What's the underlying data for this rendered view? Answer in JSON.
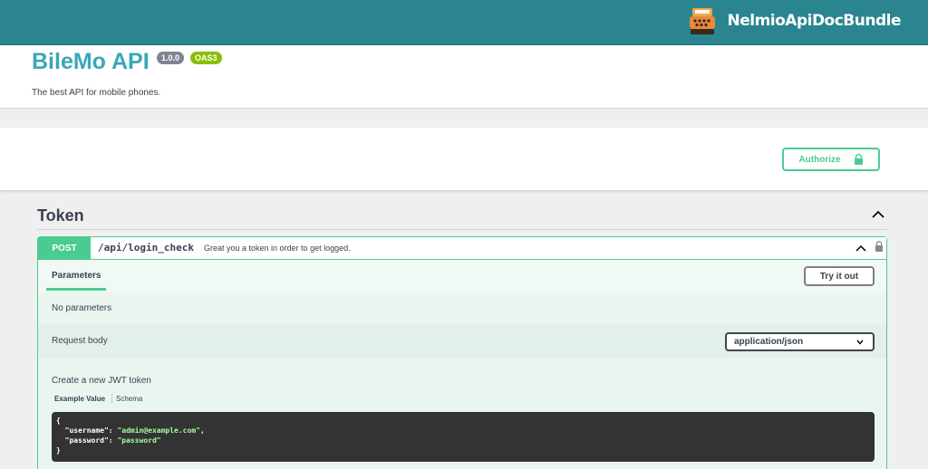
{
  "topbar": {
    "brand_name": "NelmioApiDocBundle",
    "brand_icon": "typewriter-logo",
    "bg_color": "#2a8590"
  },
  "info": {
    "title": "BileMo API",
    "version_badge": "1.0.0",
    "oas_badge": "OAS3",
    "description": "The best API for mobile phones."
  },
  "scheme": {
    "authorize_label": "Authorize",
    "authorize_icon": "lock-icon"
  },
  "tag": {
    "name": "Token",
    "chevron_icon": "chevron-up-icon"
  },
  "operation": {
    "method": "POST",
    "path": "/api/login_check",
    "summary": "Great you a token in order to get logged.",
    "method_color": "#49cc90",
    "parameters_tab": "Parameters",
    "try_it_out_label": "Try it out",
    "no_parameters_text": "No parameters",
    "request_body_label": "Request body",
    "content_type": "application/json",
    "body_description": "Create a new JWT token",
    "example_value_tab": "Example Value",
    "schema_tab": "Schema",
    "example_lines": {
      "open": "{",
      "username_key": "  \"username\": ",
      "username_value": "\"admin@example.com\"",
      "username_tail": ",",
      "password_key": "  \"password\": ",
      "password_value": "\"password\"",
      "close": "}"
    }
  }
}
